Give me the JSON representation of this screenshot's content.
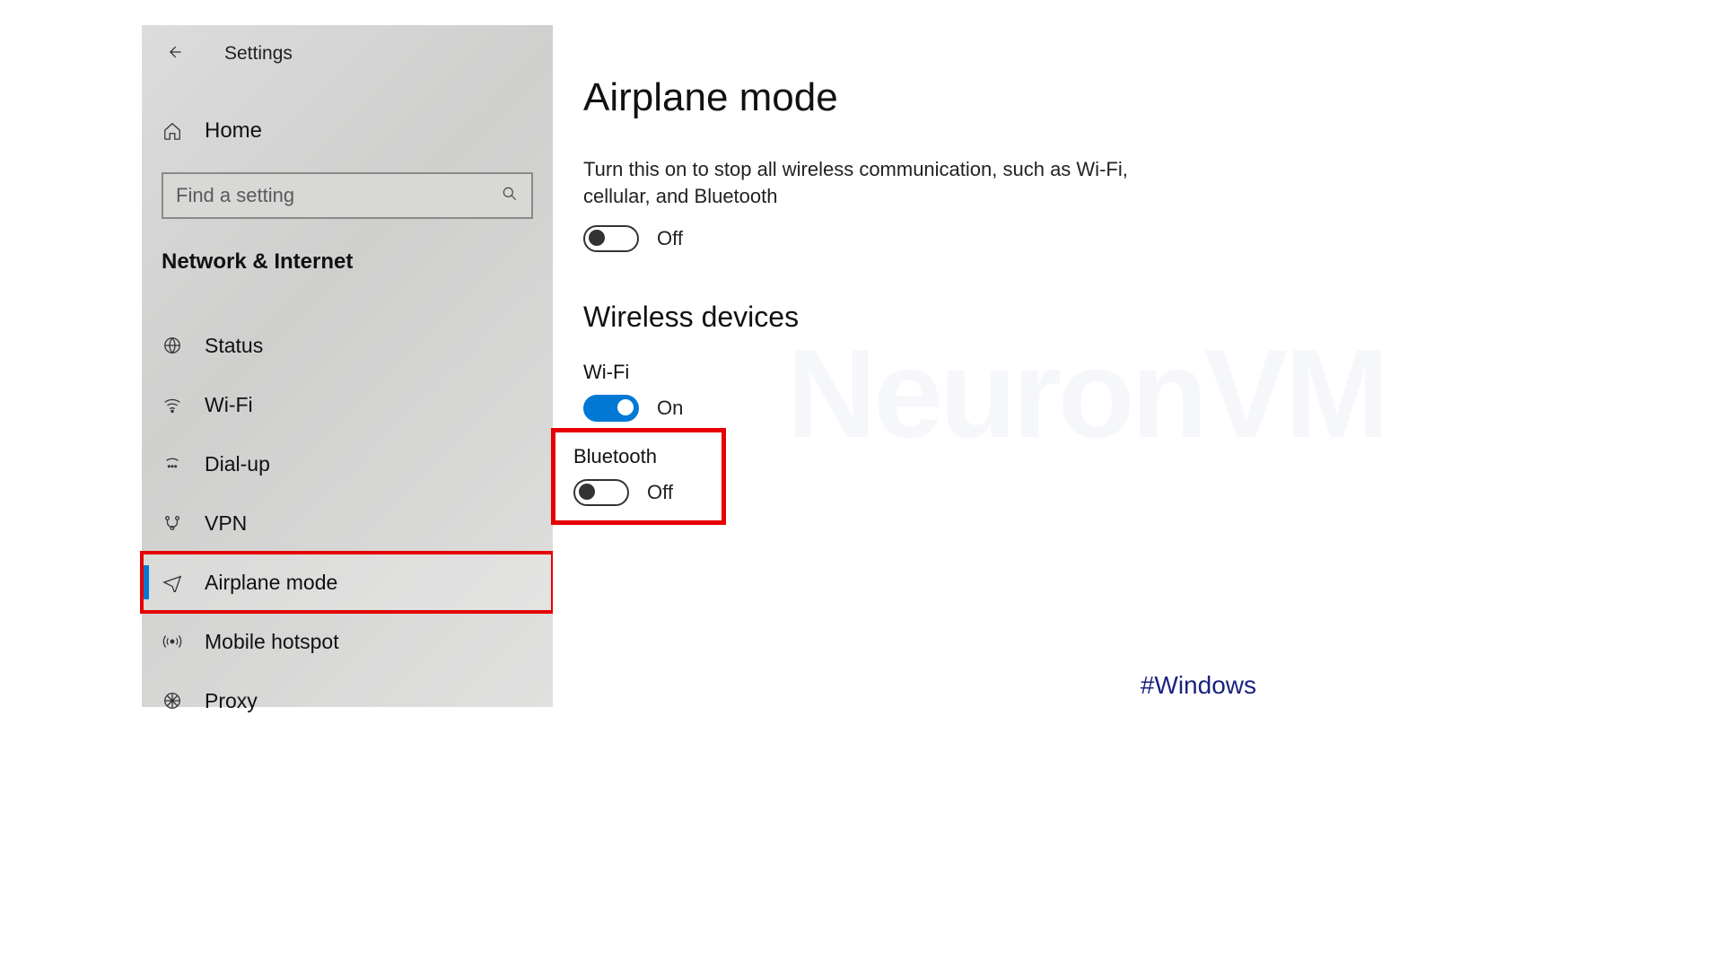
{
  "header": {
    "settings_label": "Settings",
    "home_label": "Home"
  },
  "search": {
    "placeholder": "Find a setting"
  },
  "category": {
    "title": "Network & Internet"
  },
  "nav": {
    "items": [
      {
        "id": "status",
        "label": "Status",
        "selected": false
      },
      {
        "id": "wifi",
        "label": "Wi-Fi",
        "selected": false
      },
      {
        "id": "dialup",
        "label": "Dial-up",
        "selected": false
      },
      {
        "id": "vpn",
        "label": "VPN",
        "selected": false
      },
      {
        "id": "airplane",
        "label": "Airplane mode",
        "selected": true
      },
      {
        "id": "hotspot",
        "label": "Mobile hotspot",
        "selected": false
      },
      {
        "id": "proxy",
        "label": "Proxy",
        "selected": false
      }
    ]
  },
  "main": {
    "title": "Airplane mode",
    "description": "Turn this on to stop all wireless communication, such as Wi-Fi, cellular, and Bluetooth",
    "airplane_toggle": {
      "state_label": "Off",
      "on": false
    },
    "wireless_section_title": "Wireless devices",
    "wifi": {
      "label": "Wi-Fi",
      "state_label": "On",
      "on": true
    },
    "bluetooth": {
      "label": "Bluetooth",
      "state_label": "Off",
      "on": false
    }
  },
  "annotations": {
    "highlight_sidebar": "airplane",
    "highlight_bluetooth": true,
    "watermark": "NeuronVM",
    "hashtag": "#Windows"
  }
}
